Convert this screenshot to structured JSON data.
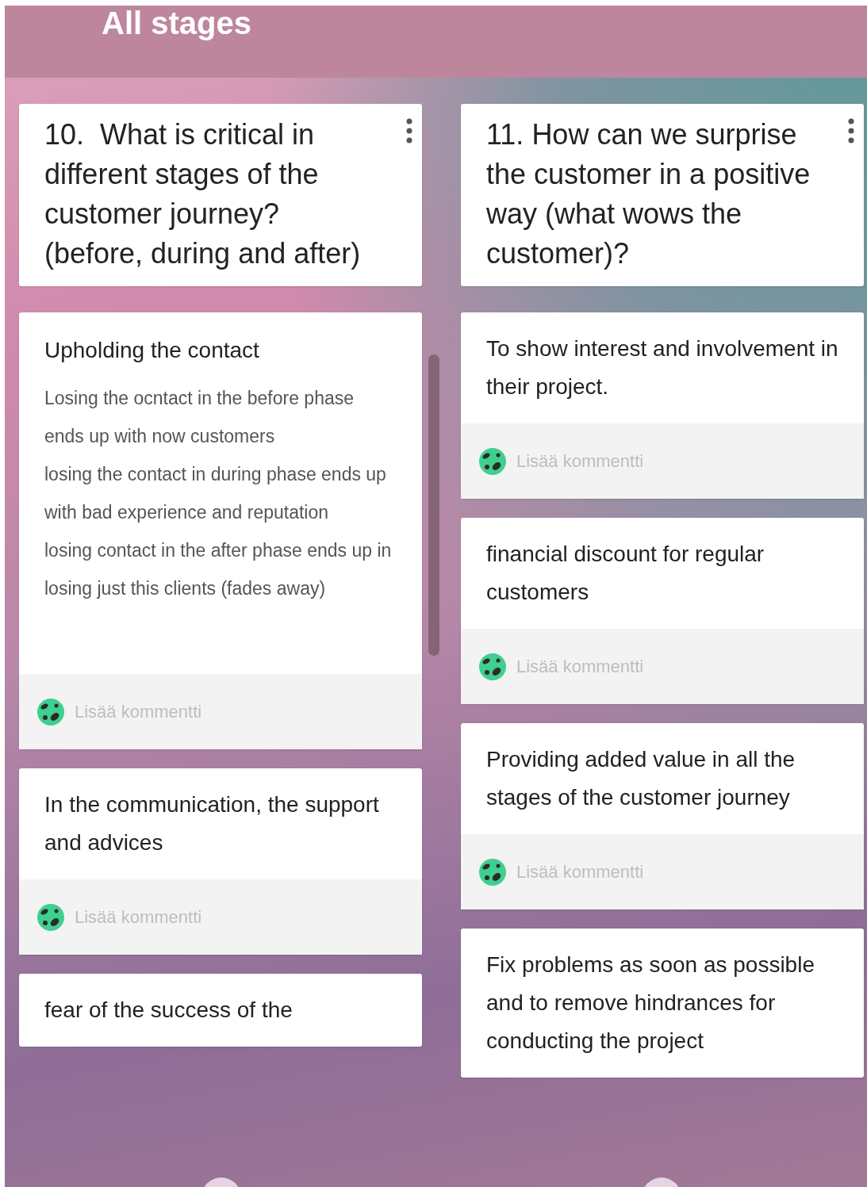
{
  "header": {
    "title": "All stages"
  },
  "columns": [
    {
      "title": "10.  What is critical in different stages of the customer journey? (before, during and after)",
      "posts": [
        {
          "subject": "Upholding the contact",
          "body": [
            "Losing the ocntact in the before phase ends up with now customers",
            "losing the contact in during phase ends up with bad experience and reputation",
            "losing contact in the after phase ends up in losing just this clients (fades away)"
          ],
          "comment_prompt": "Lisää kommentti"
        },
        {
          "subject": "In the communication, the support and advices",
          "comment_prompt": "Lisää kommentti"
        },
        {
          "subject": "fear of the success of the"
        }
      ]
    },
    {
      "title": "11. How can we surprise the customer in a positive way (what wows the customer)?",
      "posts": [
        {
          "subject": "To show interest and involvement in their project.",
          "comment_prompt": "Lisää kommentti"
        },
        {
          "subject": "financial discount for regular customers",
          "comment_prompt": "Lisää kommentti"
        },
        {
          "subject": "Providing added value in all the stages of the customer journey",
          "comment_prompt": "Lisää kommentti"
        },
        {
          "subject": "Fix problems as soon as possible and to remove hindrances for conducting the project"
        }
      ]
    }
  ]
}
